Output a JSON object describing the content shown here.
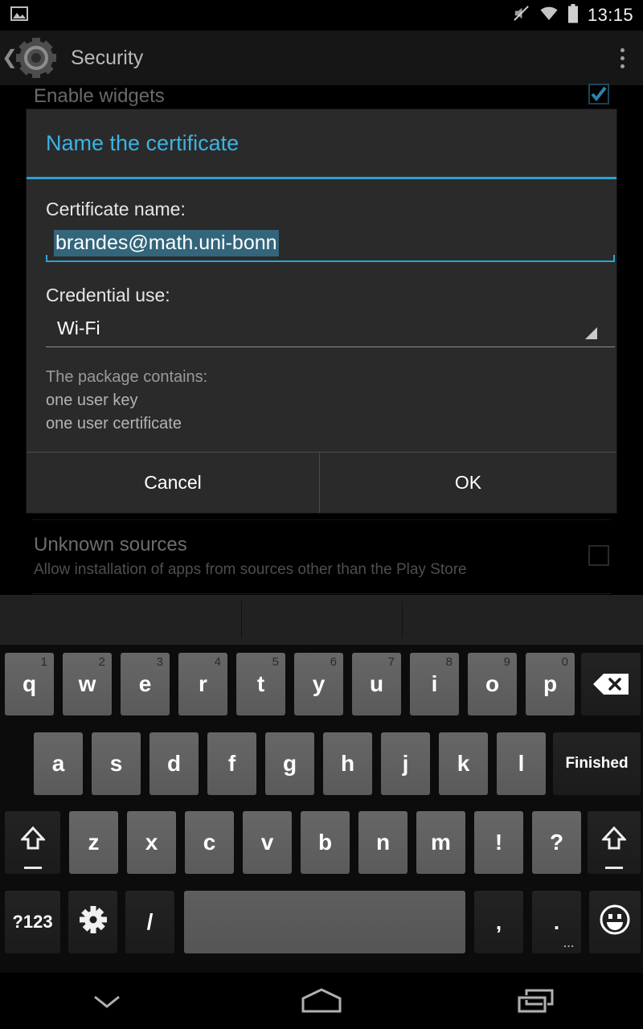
{
  "status_bar": {
    "notification_icon": "image-icon",
    "icons": [
      "volume-muted-icon",
      "wifi-icon",
      "battery-icon"
    ],
    "time": "13:15"
  },
  "action_bar": {
    "back_icon": "back-chevron-icon",
    "app_icon": "settings-gear-icon",
    "title": "Security",
    "overflow_icon": "overflow-menu-icon"
  },
  "background_page": {
    "rows": [
      {
        "title": "Enable widgets",
        "subtitle": "",
        "checkbox": "checked"
      },
      {
        "title": "Unknown sources",
        "subtitle": "Allow installation of apps from sources other than the Play Store",
        "checkbox": "unchecked"
      }
    ]
  },
  "dialog": {
    "title": "Name the certificate",
    "certificate_name_label": "Certificate name:",
    "certificate_name_value": "brandes@math.uni-bonn",
    "credential_use_label": "Credential use:",
    "credential_use_value": "Wi-Fi",
    "credential_use_options": [
      "Wi-Fi"
    ],
    "package_contains_label": "The package contains:",
    "package_contents": [
      "one user key",
      "one user certificate"
    ],
    "cancel_label": "Cancel",
    "ok_label": "OK",
    "accent_color": "#2aa3d8",
    "title_color": "#3ab3e4",
    "selection_color": "#33657b"
  },
  "keyboard": {
    "suggestions": [
      "",
      "",
      ""
    ],
    "row1": [
      {
        "label": "q",
        "hint": "1"
      },
      {
        "label": "w",
        "hint": "2"
      },
      {
        "label": "e",
        "hint": "3"
      },
      {
        "label": "r",
        "hint": "4"
      },
      {
        "label": "t",
        "hint": "5"
      },
      {
        "label": "y",
        "hint": "6"
      },
      {
        "label": "u",
        "hint": "7"
      },
      {
        "label": "i",
        "hint": "8"
      },
      {
        "label": "o",
        "hint": "9"
      },
      {
        "label": "p",
        "hint": "0"
      }
    ],
    "backspace_icon": "backspace-icon",
    "row2": [
      {
        "label": "a"
      },
      {
        "label": "s"
      },
      {
        "label": "d"
      },
      {
        "label": "f"
      },
      {
        "label": "g"
      },
      {
        "label": "h"
      },
      {
        "label": "j"
      },
      {
        "label": "k"
      },
      {
        "label": "l"
      }
    ],
    "enter_label": "Finished",
    "row3": [
      {
        "label": "z"
      },
      {
        "label": "x"
      },
      {
        "label": "c"
      },
      {
        "label": "v"
      },
      {
        "label": "b"
      },
      {
        "label": "n"
      },
      {
        "label": "m"
      },
      {
        "label": "!"
      },
      {
        "label": "?"
      }
    ],
    "shift_icon": "shift-icon",
    "symbols_label": "?123",
    "settings_icon": "keyboard-settings-gear-icon",
    "slash_label": "/",
    "space_label": "",
    "comma_label": ",",
    "period_label": ".",
    "period_more": "...",
    "emoji_icon": "emoji-smiley-icon"
  },
  "nav_bar": {
    "back_icon": "hide-keyboard-chevron-icon",
    "home_icon": "home-icon",
    "recents_icon": "recents-icon"
  }
}
